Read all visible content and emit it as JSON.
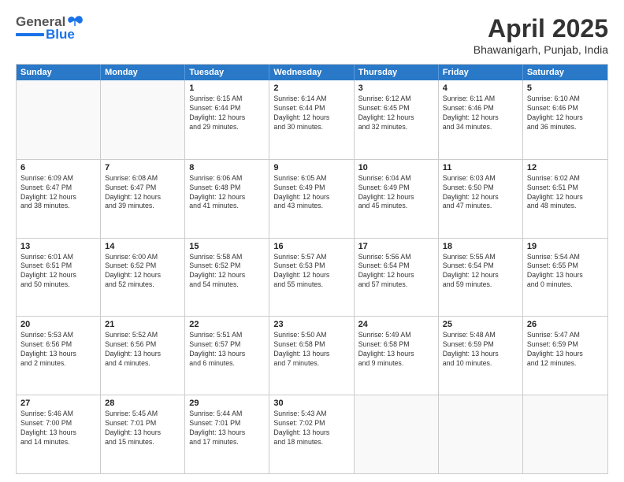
{
  "header": {
    "logo_general": "General",
    "logo_blue": "Blue",
    "month_title": "April 2025",
    "location": "Bhawanigarh, Punjab, India"
  },
  "weekdays": [
    "Sunday",
    "Monday",
    "Tuesday",
    "Wednesday",
    "Thursday",
    "Friday",
    "Saturday"
  ],
  "weeks": [
    [
      {
        "day": "",
        "info": ""
      },
      {
        "day": "",
        "info": ""
      },
      {
        "day": "1",
        "info": "Sunrise: 6:15 AM\nSunset: 6:44 PM\nDaylight: 12 hours\nand 29 minutes."
      },
      {
        "day": "2",
        "info": "Sunrise: 6:14 AM\nSunset: 6:44 PM\nDaylight: 12 hours\nand 30 minutes."
      },
      {
        "day": "3",
        "info": "Sunrise: 6:12 AM\nSunset: 6:45 PM\nDaylight: 12 hours\nand 32 minutes."
      },
      {
        "day": "4",
        "info": "Sunrise: 6:11 AM\nSunset: 6:46 PM\nDaylight: 12 hours\nand 34 minutes."
      },
      {
        "day": "5",
        "info": "Sunrise: 6:10 AM\nSunset: 6:46 PM\nDaylight: 12 hours\nand 36 minutes."
      }
    ],
    [
      {
        "day": "6",
        "info": "Sunrise: 6:09 AM\nSunset: 6:47 PM\nDaylight: 12 hours\nand 38 minutes."
      },
      {
        "day": "7",
        "info": "Sunrise: 6:08 AM\nSunset: 6:47 PM\nDaylight: 12 hours\nand 39 minutes."
      },
      {
        "day": "8",
        "info": "Sunrise: 6:06 AM\nSunset: 6:48 PM\nDaylight: 12 hours\nand 41 minutes."
      },
      {
        "day": "9",
        "info": "Sunrise: 6:05 AM\nSunset: 6:49 PM\nDaylight: 12 hours\nand 43 minutes."
      },
      {
        "day": "10",
        "info": "Sunrise: 6:04 AM\nSunset: 6:49 PM\nDaylight: 12 hours\nand 45 minutes."
      },
      {
        "day": "11",
        "info": "Sunrise: 6:03 AM\nSunset: 6:50 PM\nDaylight: 12 hours\nand 47 minutes."
      },
      {
        "day": "12",
        "info": "Sunrise: 6:02 AM\nSunset: 6:51 PM\nDaylight: 12 hours\nand 48 minutes."
      }
    ],
    [
      {
        "day": "13",
        "info": "Sunrise: 6:01 AM\nSunset: 6:51 PM\nDaylight: 12 hours\nand 50 minutes."
      },
      {
        "day": "14",
        "info": "Sunrise: 6:00 AM\nSunset: 6:52 PM\nDaylight: 12 hours\nand 52 minutes."
      },
      {
        "day": "15",
        "info": "Sunrise: 5:58 AM\nSunset: 6:52 PM\nDaylight: 12 hours\nand 54 minutes."
      },
      {
        "day": "16",
        "info": "Sunrise: 5:57 AM\nSunset: 6:53 PM\nDaylight: 12 hours\nand 55 minutes."
      },
      {
        "day": "17",
        "info": "Sunrise: 5:56 AM\nSunset: 6:54 PM\nDaylight: 12 hours\nand 57 minutes."
      },
      {
        "day": "18",
        "info": "Sunrise: 5:55 AM\nSunset: 6:54 PM\nDaylight: 12 hours\nand 59 minutes."
      },
      {
        "day": "19",
        "info": "Sunrise: 5:54 AM\nSunset: 6:55 PM\nDaylight: 13 hours\nand 0 minutes."
      }
    ],
    [
      {
        "day": "20",
        "info": "Sunrise: 5:53 AM\nSunset: 6:56 PM\nDaylight: 13 hours\nand 2 minutes."
      },
      {
        "day": "21",
        "info": "Sunrise: 5:52 AM\nSunset: 6:56 PM\nDaylight: 13 hours\nand 4 minutes."
      },
      {
        "day": "22",
        "info": "Sunrise: 5:51 AM\nSunset: 6:57 PM\nDaylight: 13 hours\nand 6 minutes."
      },
      {
        "day": "23",
        "info": "Sunrise: 5:50 AM\nSunset: 6:58 PM\nDaylight: 13 hours\nand 7 minutes."
      },
      {
        "day": "24",
        "info": "Sunrise: 5:49 AM\nSunset: 6:58 PM\nDaylight: 13 hours\nand 9 minutes."
      },
      {
        "day": "25",
        "info": "Sunrise: 5:48 AM\nSunset: 6:59 PM\nDaylight: 13 hours\nand 10 minutes."
      },
      {
        "day": "26",
        "info": "Sunrise: 5:47 AM\nSunset: 6:59 PM\nDaylight: 13 hours\nand 12 minutes."
      }
    ],
    [
      {
        "day": "27",
        "info": "Sunrise: 5:46 AM\nSunset: 7:00 PM\nDaylight: 13 hours\nand 14 minutes."
      },
      {
        "day": "28",
        "info": "Sunrise: 5:45 AM\nSunset: 7:01 PM\nDaylight: 13 hours\nand 15 minutes."
      },
      {
        "day": "29",
        "info": "Sunrise: 5:44 AM\nSunset: 7:01 PM\nDaylight: 13 hours\nand 17 minutes."
      },
      {
        "day": "30",
        "info": "Sunrise: 5:43 AM\nSunset: 7:02 PM\nDaylight: 13 hours\nand 18 minutes."
      },
      {
        "day": "",
        "info": ""
      },
      {
        "day": "",
        "info": ""
      },
      {
        "day": "",
        "info": ""
      }
    ]
  ]
}
